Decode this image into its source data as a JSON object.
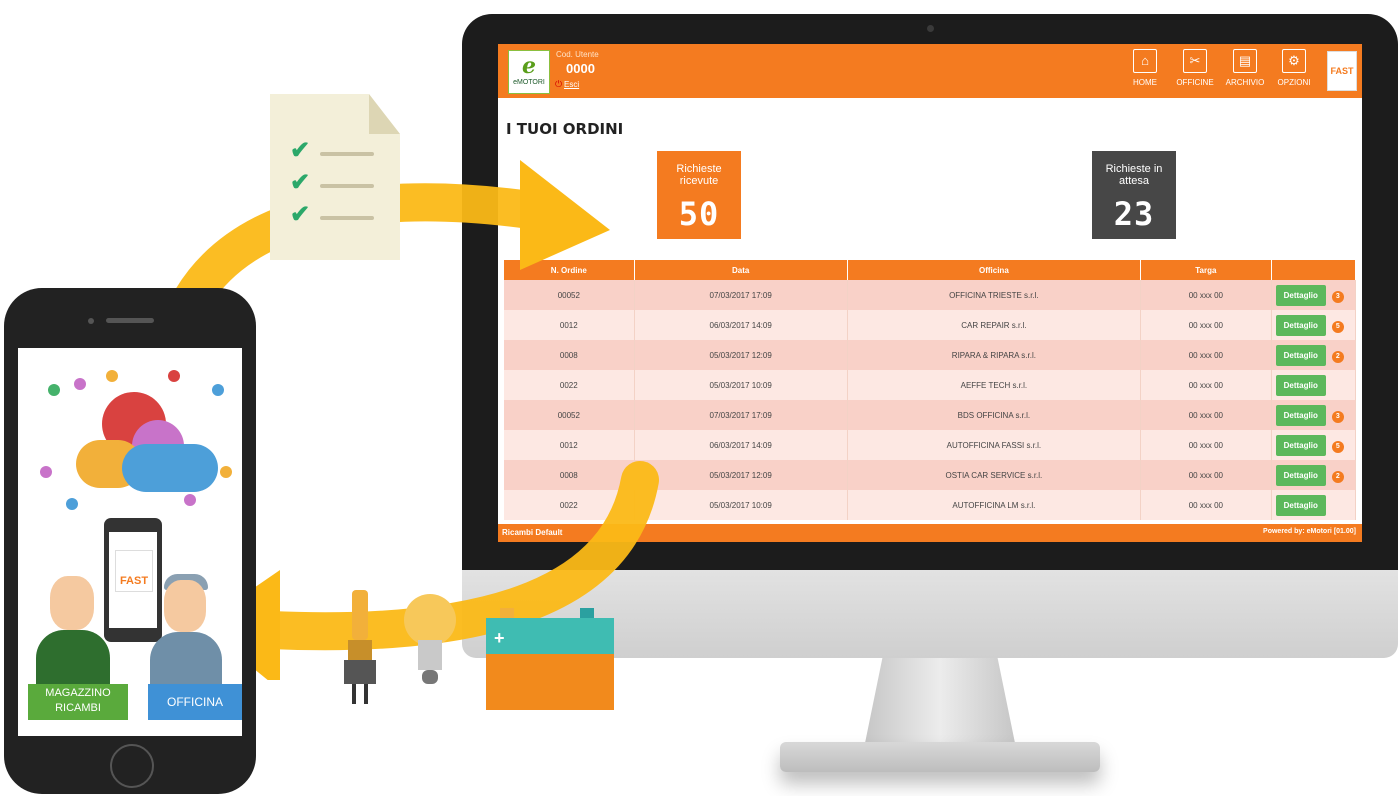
{
  "app": {
    "cod_label": "Cod. Utente",
    "cod_value": "0000",
    "logout_label": "Esci",
    "logo_text": "eMOTORI",
    "fast_logo": "FAST"
  },
  "nav": [
    {
      "label": "HOME",
      "icon": "home-icon",
      "glyph": "⌂"
    },
    {
      "label": "OFFICINE",
      "icon": "tools-icon",
      "glyph": "✂"
    },
    {
      "label": "ARCHIVIO",
      "icon": "archive-icon",
      "glyph": "▤"
    },
    {
      "label": "OPZIONI",
      "icon": "gear-icon",
      "glyph": "⚙"
    }
  ],
  "page": {
    "title": "I TUOI ORDINI"
  },
  "counters": {
    "received": {
      "label": "Richieste ricevute",
      "value": "50"
    },
    "waiting": {
      "label": "Richieste in attesa",
      "value": "23"
    }
  },
  "table": {
    "headers": [
      "N. Ordine",
      "Data",
      "Officina",
      "Targa",
      ""
    ],
    "detail_label": "Dettaglio",
    "rows": [
      {
        "order": "00052",
        "date": "07/03/2017 17:09",
        "shop": "OFFICINA TRIESTE s.r.l.",
        "plate": "00 xxx 00",
        "badge": "3"
      },
      {
        "order": "0012",
        "date": "06/03/2017 14:09",
        "shop": "CAR REPAIR s.r.l.",
        "plate": "00 xxx 00",
        "badge": "5"
      },
      {
        "order": "0008",
        "date": "05/03/2017 12:09",
        "shop": "RIPARA & RIPARA s.r.l.",
        "plate": "00 xxx 00",
        "badge": "2"
      },
      {
        "order": "0022",
        "date": "05/03/2017 10:09",
        "shop": "AEFFE TECH s.r.l.",
        "plate": "00 xxx 00",
        "badge": ""
      },
      {
        "order": "00052",
        "date": "07/03/2017 17:09",
        "shop": "BDS OFFICINA s.r.l.",
        "plate": "00 xxx 00",
        "badge": "3"
      },
      {
        "order": "0012",
        "date": "06/03/2017 14:09",
        "shop": "AUTOFFICINA FASSI s.r.l.",
        "plate": "00 xxx 00",
        "badge": "5"
      },
      {
        "order": "0008",
        "date": "05/03/2017 12:09",
        "shop": "OSTIA CAR SERVICE s.r.l.",
        "plate": "00 xxx 00",
        "badge": "2"
      },
      {
        "order": "0022",
        "date": "05/03/2017 10:09",
        "shop": "AUTOFFICINA LM s.r.l.",
        "plate": "00 xxx 00",
        "badge": ""
      }
    ]
  },
  "footer": {
    "left": "Ricambi Default",
    "right": "Powered by: eMotori [01.00]"
  },
  "phone": {
    "label_left": "MAGAZZINO RICAMBI",
    "label_right": "OFFICINA",
    "mini_logo": "FAST"
  },
  "colors": {
    "brand": "#f47b20",
    "dark": "#474747",
    "success": "#5cb85c",
    "arrow": "#fbb917",
    "check": "#2ba86a"
  }
}
